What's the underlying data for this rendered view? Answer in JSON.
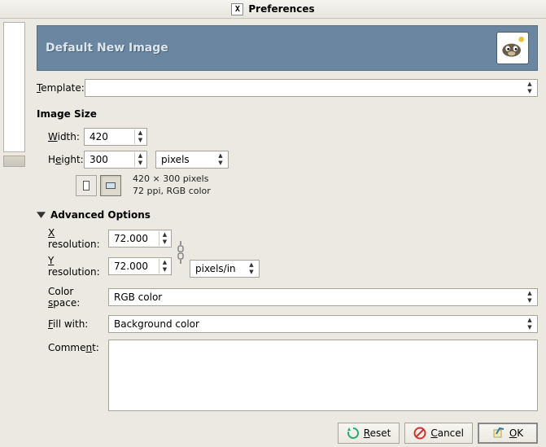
{
  "window": {
    "title": "Preferences"
  },
  "banner": {
    "title": "Default New Image"
  },
  "template": {
    "label": "Template:",
    "value": ""
  },
  "image_size": {
    "title": "Image Size",
    "width_label": "Width:",
    "width_value": "420",
    "height_label": "Height:",
    "height_value": "300",
    "unit": "pixels",
    "info_line1": "420 × 300 pixels",
    "info_line2": "72 ppi, RGB color"
  },
  "advanced": {
    "toggle_label": "Advanced Options",
    "xres_label": "X resolution:",
    "xres_value": "72.000",
    "yres_label": "Y resolution:",
    "yres_value": "72.000",
    "res_unit": "pixels/in",
    "colorspace_label": "Color space:",
    "colorspace_value": "RGB color",
    "fill_label": "Fill with:",
    "fill_value": "Background color",
    "comment_label": "Comment:",
    "comment_value": ""
  },
  "buttons": {
    "reset": "Reset",
    "cancel": "Cancel",
    "ok": "OK"
  }
}
